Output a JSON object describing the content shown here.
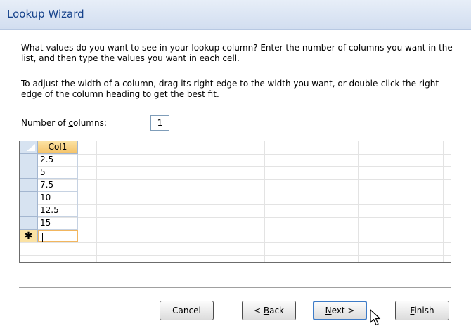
{
  "window": {
    "title": "Lookup Wizard"
  },
  "intro_text": "What values do you want to see in your lookup column? Enter the number of columns you want in the list, and then type the values you want in each cell.",
  "hint_text": "To adjust the width of a column, drag its right edge to the width you want, or double-click the right edge of the column heading to get the best fit.",
  "columns_field": {
    "label_pre": "Number of ",
    "label_accel": "c",
    "label_post": "olumns:",
    "value": "1"
  },
  "grid": {
    "column_header": "Col1",
    "rows": [
      "2.5",
      "5",
      "7.5",
      "10",
      "12.5",
      "15"
    ],
    "new_row_marker": "✱",
    "new_row_value": ""
  },
  "buttons": {
    "cancel": "Cancel",
    "back_pre": "< ",
    "back_accel": "B",
    "back_post": "ack",
    "next_accel": "N",
    "next_post": "ext >",
    "finish_accel": "F",
    "finish_post": "inish"
  },
  "colors": {
    "title_text": "#15428b",
    "header_fill": "#f4c36a",
    "selector_fill": "#d7e3f1",
    "default_button_border": "#3d7bc7"
  }
}
